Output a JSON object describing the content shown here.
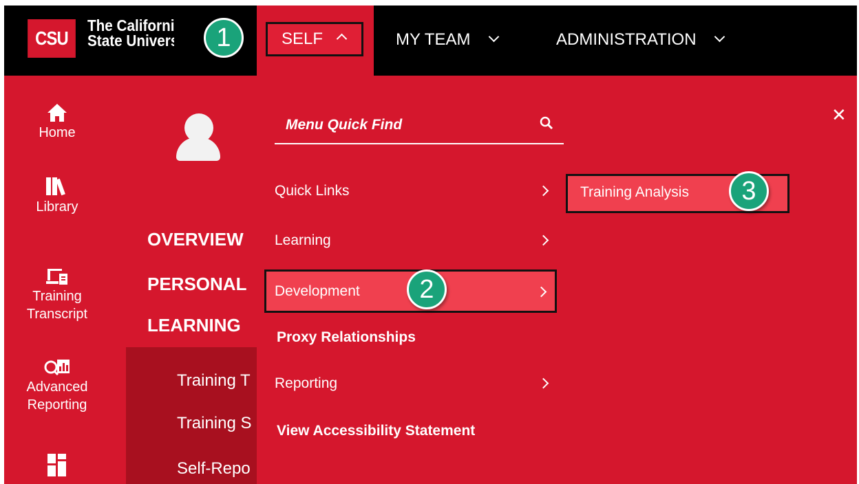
{
  "header": {
    "logo_mark": "CSU",
    "logo_line1": "The California",
    "logo_line2": "State University",
    "nav": {
      "self": "SELF",
      "my_team": "MY TEAM",
      "administration": "ADMINISTRATION"
    }
  },
  "steps": [
    "1",
    "2",
    "3"
  ],
  "sidebar": {
    "items": [
      {
        "label": "Home",
        "icon": "home-icon"
      },
      {
        "label": "Library",
        "icon": "library-icon"
      },
      {
        "label_line1": "Training",
        "label_line2": "Transcript",
        "icon": "transcript-icon"
      },
      {
        "label_line1": "Advanced",
        "label_line2": "Reporting",
        "icon": "reporting-icon"
      },
      {
        "icon": "dashboard-icon"
      }
    ]
  },
  "page": {
    "sections": [
      "OVERVIEW",
      "PERSONAL",
      "LEARNING"
    ],
    "sub_items": [
      "Training T",
      "Training S",
      "Self-Repo"
    ]
  },
  "menu": {
    "quick_find_placeholder": "Menu Quick Find",
    "items": [
      {
        "label": "Quick Links",
        "has_submenu": true
      },
      {
        "label": "Learning",
        "has_submenu": true
      },
      {
        "label": "Development",
        "has_submenu": true,
        "active": true
      },
      {
        "label": "Proxy Relationships",
        "has_submenu": false
      },
      {
        "label": "Reporting",
        "has_submenu": true
      },
      {
        "label": "View Accessibility Statement",
        "has_submenu": false
      }
    ],
    "submenu_item": "Training Analysis",
    "close_symbol": "✕"
  },
  "colors": {
    "brand_red": "#d5172d",
    "highlight": "#f0404f",
    "step_green": "#1aa37a",
    "topbar": "#000000"
  }
}
